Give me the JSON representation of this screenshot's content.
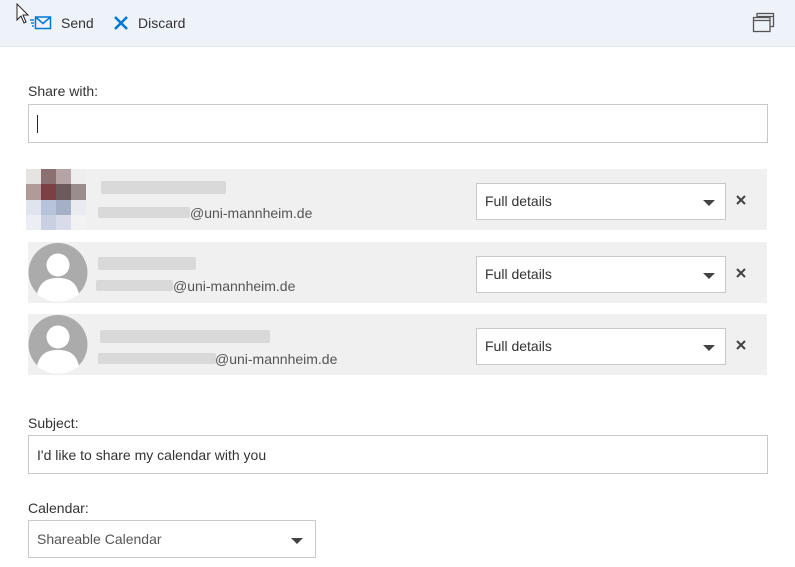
{
  "toolbar": {
    "send_label": "Send",
    "discard_label": "Discard",
    "send_icon": "send-mail-icon",
    "discard_icon": "close-icon",
    "popout_icon": "popout-window-icon",
    "accent_color": "#0078d4"
  },
  "share_with": {
    "label": "Share with:",
    "value": ""
  },
  "recipients": [
    {
      "email_domain": "@uni-mannheim.de",
      "permission": "Full details",
      "avatar": "photo"
    },
    {
      "email_domain": "@uni-mannheim.de",
      "permission": "Full details",
      "avatar": "default-person-icon"
    },
    {
      "email_domain": "@uni-mannheim.de",
      "permission": "Full details",
      "avatar": "default-person-icon"
    }
  ],
  "subject": {
    "label": "Subject:",
    "value": "I'd like to share my calendar with you"
  },
  "calendar": {
    "label": "Calendar:",
    "selected": "Shareable Calendar"
  }
}
